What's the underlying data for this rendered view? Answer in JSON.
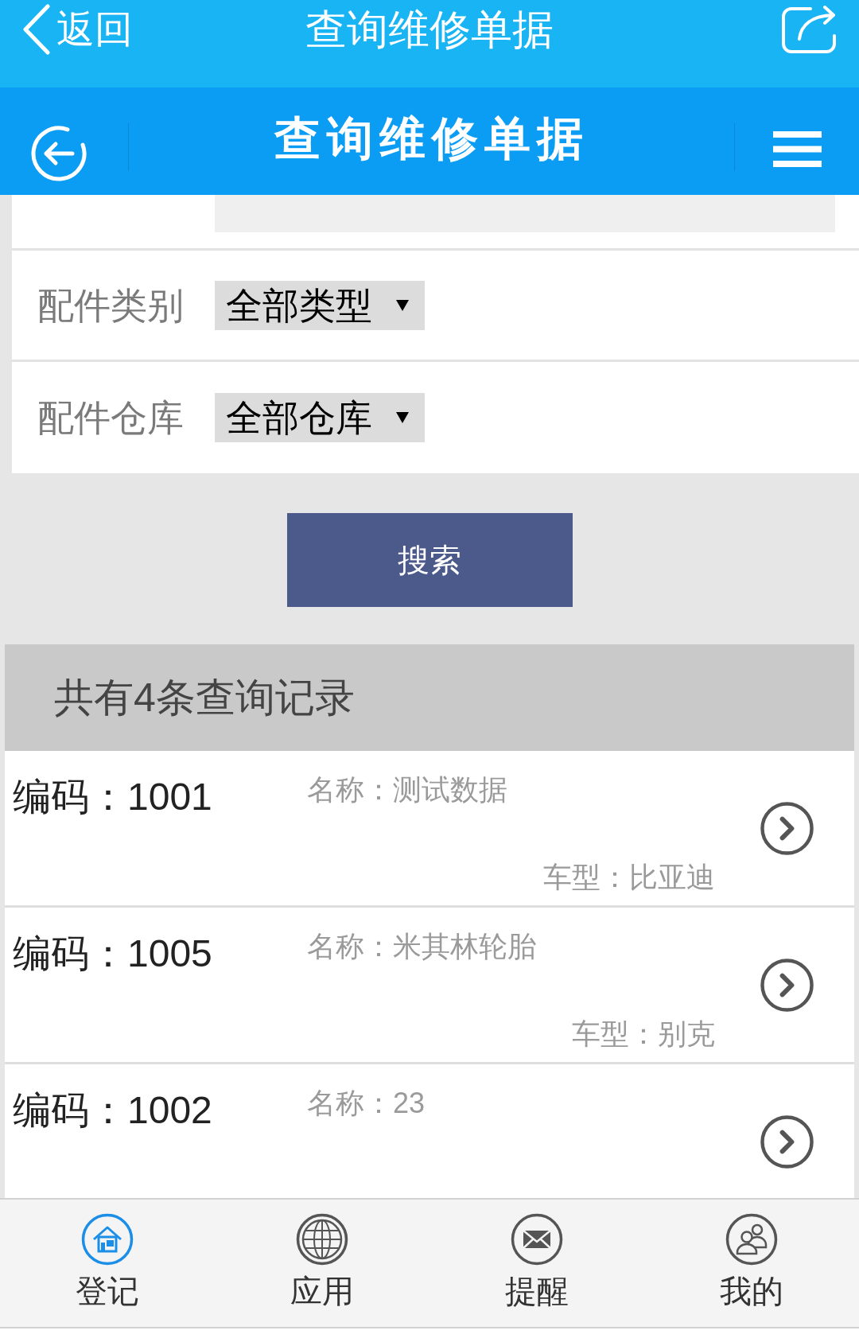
{
  "top_bar": {
    "back_label": "返回",
    "title": "查询维修单据"
  },
  "header": {
    "title": "查询维修单据"
  },
  "filters": [
    {
      "label": "配件类别",
      "value": "全部类型"
    },
    {
      "label": "配件仓库",
      "value": "全部仓库"
    }
  ],
  "search_button": "搜索",
  "results": {
    "summary": "共有4条查询记录",
    "items": [
      {
        "code": "编码：1001",
        "name": "名称：测试数据",
        "model": "车型：比亚迪"
      },
      {
        "code": "编码：1005",
        "name": "名称：米其林轮胎",
        "model": "车型：别克"
      },
      {
        "code": "编码：1002",
        "name": "名称：23"
      }
    ]
  },
  "tab_bar": [
    {
      "label": "登记",
      "selected": true
    },
    {
      "label": "应用",
      "selected": false
    },
    {
      "label": "提醒",
      "selected": false
    },
    {
      "label": "我的",
      "selected": false
    }
  ]
}
